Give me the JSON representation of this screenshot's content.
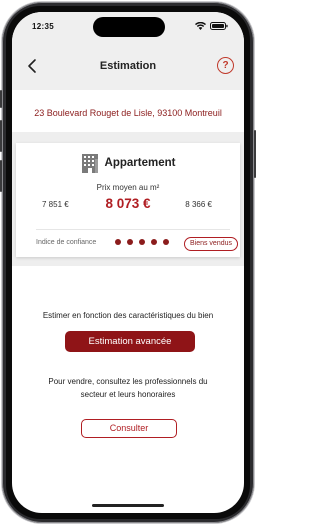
{
  "status_bar": {
    "time": "12:35"
  },
  "nav": {
    "title": "Estimation",
    "help_label": "?"
  },
  "address": "23 Boulevard Rouget de Lisle, 93100 Montreuil",
  "estimate_card": {
    "property_type": "Appartement",
    "price_caption": "Prix moyen au m²",
    "price_low": "7 851 €",
    "price_main": "8 073 €",
    "price_high": "8 366 €",
    "confidence_label": "Indice de confiance",
    "confidence_level": 5,
    "sold_button_label": "Biens vendus"
  },
  "advanced": {
    "caption": "Estimer en fonction des caractéristiques du bien",
    "button_label": "Estimation avancée"
  },
  "sell": {
    "caption": "Pour vendre, consultez les professionnels du secteur et leurs honoraires",
    "button_label": "Consulter"
  },
  "colors": {
    "accent": "#b01e23",
    "accent_dark": "#8f1417",
    "address": "#8b1c1c"
  },
  "icons": {
    "back": "chevron-left-icon",
    "help": "question-circle-icon",
    "building": "building-icon"
  }
}
